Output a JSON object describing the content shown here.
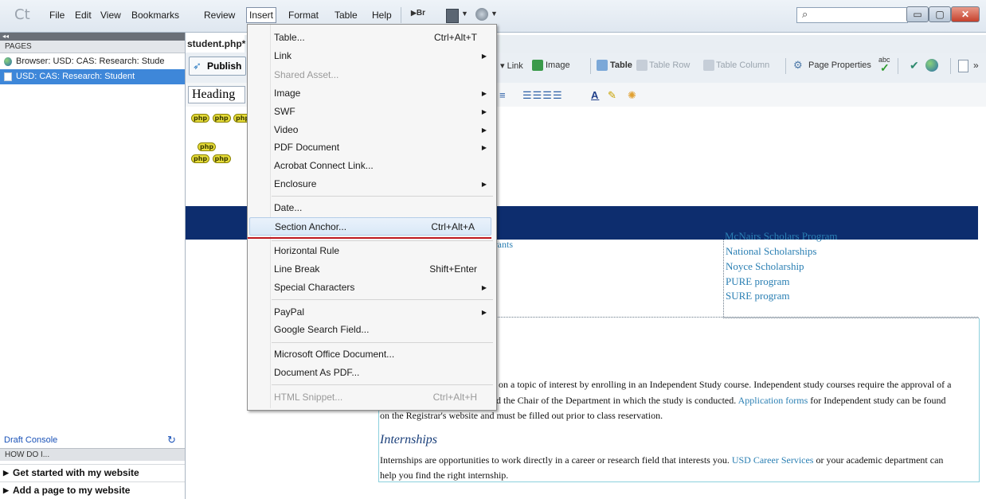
{
  "app": {
    "logo": "Ct"
  },
  "menubar": {
    "items": [
      "File",
      "Edit",
      "View",
      "Bookmarks",
      "Review",
      "Insert",
      "Format",
      "Table",
      "Help"
    ]
  },
  "toolbar_top": {
    "br_label": "Br"
  },
  "search": {
    "placeholder": ""
  },
  "left_panel": {
    "pages_header": "PAGES",
    "items": [
      "Browser: USD: CAS: Research: Stude",
      "USD: CAS: Research: Student"
    ],
    "draft_console": "Draft Console",
    "howdoi_header": "HOW DO I...",
    "howdoi_items": [
      "Get started with my website",
      "Add a page to my website"
    ]
  },
  "editor": {
    "doc_tab": "student.php*",
    "publish_label": "Publish",
    "toolbar1": {
      "link": "Link",
      "image": "Image",
      "table": "Table",
      "table_row": "Table Row",
      "table_column": "Table Column",
      "page_properties": "Page Properties",
      "spell": "abc"
    },
    "heading_value": "Heading",
    "php_tag": "php"
  },
  "insert_menu": {
    "items": [
      {
        "label": "Table...",
        "shortcut": "Ctrl+Alt+T"
      },
      {
        "label": "Link",
        "submenu": true
      },
      {
        "label": "Shared Asset...",
        "disabled": true
      },
      {
        "label": "Image",
        "submenu": true
      },
      {
        "label": "SWF",
        "submenu": true
      },
      {
        "label": "Video",
        "submenu": true
      },
      {
        "label": "PDF Document",
        "submenu": true
      },
      {
        "label": "Acrobat Connect Link..."
      },
      {
        "label": "Enclosure",
        "submenu": true
      },
      {
        "label": "Date..."
      },
      {
        "label": "Section Anchor...",
        "shortcut": "Ctrl+Alt+A",
        "highlighted": true
      },
      {
        "label": "Horizontal Rule"
      },
      {
        "label": "Line Break",
        "shortcut": "Shift+Enter"
      },
      {
        "label": "Special Characters",
        "submenu": true
      },
      {
        "label": "PayPal",
        "submenu": true
      },
      {
        "label": "Google Search Field..."
      },
      {
        "label": "Microsoft Office Document..."
      },
      {
        "label": "Document As PDF..."
      },
      {
        "label": "HTML Snippet...",
        "shortcut": "Ctrl+Alt+H",
        "disabled": true
      }
    ]
  },
  "page_content": {
    "mcnairs": "McNairs Scholars Program",
    "grants": "ll grants",
    "scholarships": [
      "National Scholarships",
      "Noyce Scholarship",
      "PURE program",
      "SURE program"
    ],
    "independent_text_1": "h on a topic of interest by enrolling in an Independent Study course. Independent study courses require the approval of a",
    "independent_text_2a": "nd the Chair of the Department in which the study is conducted. ",
    "independent_link": "Application forms",
    "independent_text_2b": " for Independent study can be found",
    "independent_text_3": "on the Registrar's website and must be filled out prior to class reservation.",
    "internships_heading": "Internships",
    "internships_text_1a": "Internships are opportunities to work directly in a career or research field that interests you. ",
    "internships_link": "USD Career Services",
    "internships_text_1b": " or your academic department can",
    "internships_text_2": "help you find the right internship."
  },
  "colors": {
    "accent": "#3e87d9",
    "band": "#0d2d6e",
    "link": "#2a7fb3",
    "underline": "#c0181f"
  }
}
